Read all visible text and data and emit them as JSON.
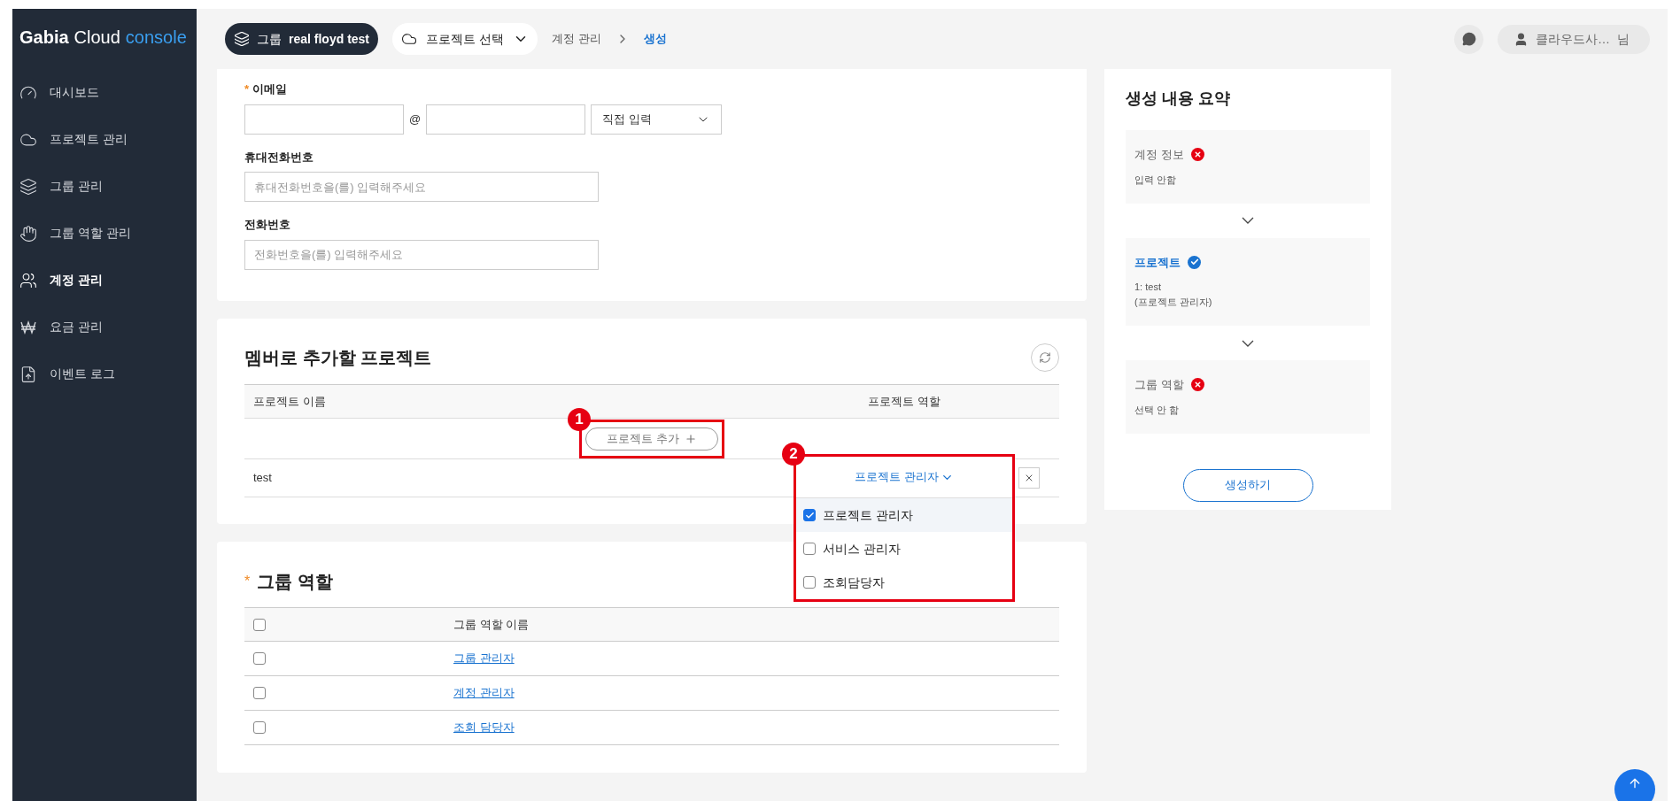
{
  "logo": {
    "brand": "Gabia",
    "product": "Cloud",
    "suffix": "console"
  },
  "sidebar": {
    "items": [
      {
        "label": "대시보드",
        "selected": false
      },
      {
        "label": "프로젝트 관리",
        "selected": false
      },
      {
        "label": "그룹 관리",
        "selected": false
      },
      {
        "label": "그룹 역할 관리",
        "selected": false
      },
      {
        "label": "계정 관리",
        "selected": true
      },
      {
        "label": "요금 관리",
        "selected": false
      },
      {
        "label": "이벤트 로그",
        "selected": false
      }
    ]
  },
  "header": {
    "group_chip": {
      "label": "그룹",
      "name": "real floyd test"
    },
    "project_select": "프로젝트 선택",
    "breadcrumb": [
      {
        "label": "계정 관리",
        "current": false
      },
      {
        "label": "생성",
        "current": true
      }
    ],
    "user": {
      "name": "클라우드사…",
      "suffix": "님"
    }
  },
  "account_form": {
    "email": {
      "label": "이메일",
      "required_mark": "*",
      "at": "@",
      "domain_select": "직접 입력"
    },
    "mobile": {
      "label": "휴대전화번호",
      "placeholder": "휴대전화번호을(를) 입력해주세요"
    },
    "phone": {
      "label": "전화번호",
      "placeholder": "전화번호을(를) 입력해주세요"
    }
  },
  "projects": {
    "title": "멤버로 추가할 프로젝트",
    "columns": [
      "프로젝트 이름",
      "프로젝트 역할"
    ],
    "add_button": "프로젝트 추가",
    "rows": [
      {
        "name": "test",
        "role": "프로젝트 관리자",
        "expanded": true,
        "options": [
          {
            "label": "프로젝트 관리자",
            "checked": true,
            "selected": true
          },
          {
            "label": "서비스 관리자",
            "checked": false,
            "selected": false
          },
          {
            "label": "조회담당자",
            "checked": false,
            "selected": false
          }
        ]
      }
    ]
  },
  "annotations": [
    {
      "number": "1"
    },
    {
      "number": "2"
    }
  ],
  "group_roles": {
    "title": "그룹 역할",
    "required_mark": "*",
    "header_checked": false,
    "columns": [
      "그룹 역할 이름"
    ],
    "rows": [
      {
        "name": "그룹 관리자",
        "checked": false
      },
      {
        "name": "계정 관리자",
        "checked": false
      },
      {
        "name": "조회 담당자",
        "checked": false
      }
    ]
  },
  "summary": {
    "title": "생성 내용 요약",
    "button": "생성하기",
    "steps": [
      {
        "title": "계정 정보",
        "complete": false,
        "lines": [
          "입력 안함"
        ]
      },
      {
        "title": "프로젝트",
        "complete": true,
        "lines": [
          "1: test",
          "(프로젝트 관리자)"
        ]
      },
      {
        "title": "그룹 역할",
        "complete": false,
        "lines": [
          "선택 안 함"
        ]
      }
    ]
  }
}
